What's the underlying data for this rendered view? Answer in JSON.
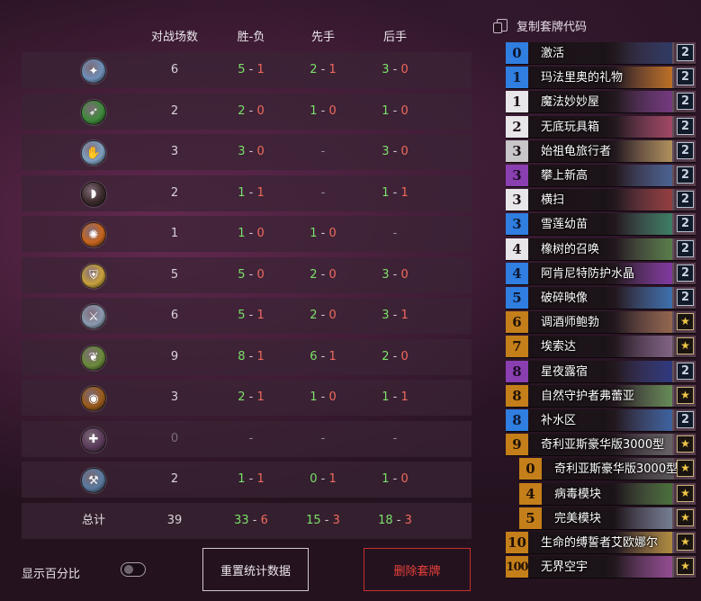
{
  "headers": {
    "games": "对战场数",
    "wl": "胜-负",
    "first": "先手",
    "second": "后手"
  },
  "rows": [
    {
      "icon": "mage-class-icon",
      "glyph": "✦",
      "color": "#6f8fb8",
      "games": "6",
      "wl": [
        "5",
        "1"
      ],
      "first": [
        "2",
        "1"
      ],
      "second": [
        "3",
        "0"
      ]
    },
    {
      "icon": "hunter-class-icon",
      "glyph": "➶",
      "color": "#3d8a3a",
      "games": "2",
      "wl": [
        "2",
        "0"
      ],
      "first": [
        "1",
        "0"
      ],
      "second": [
        "1",
        "0"
      ]
    },
    {
      "icon": "shaman-class-icon",
      "glyph": "✋",
      "color": "#7ea0c0",
      "games": "3",
      "wl": [
        "3",
        "0"
      ],
      "first": "-",
      "second": [
        "3",
        "0"
      ]
    },
    {
      "icon": "rogue-class-icon",
      "glyph": "◗",
      "color": "#3a2a2a",
      "games": "2",
      "wl": [
        "1",
        "1"
      ],
      "first": "-",
      "second": [
        "1",
        "1"
      ]
    },
    {
      "icon": "warlock-class-icon",
      "glyph": "✺",
      "color": "#c8641c",
      "games": "1",
      "wl": [
        "1",
        "0"
      ],
      "first": [
        "1",
        "0"
      ],
      "second": "-"
    },
    {
      "icon": "paladin-class-icon",
      "glyph": "⛨",
      "color": "#c9a13a",
      "games": "5",
      "wl": [
        "5",
        "0"
      ],
      "first": [
        "2",
        "0"
      ],
      "second": [
        "3",
        "0"
      ]
    },
    {
      "icon": "warrior-class-icon",
      "glyph": "⚔",
      "color": "#8a9ab0",
      "games": "6",
      "wl": [
        "5",
        "1"
      ],
      "first": [
        "2",
        "0"
      ],
      "second": [
        "3",
        "1"
      ]
    },
    {
      "icon": "druid-class-icon",
      "glyph": "❦",
      "color": "#6a8a3a",
      "games": "9",
      "wl": [
        "8",
        "1"
      ],
      "first": [
        "6",
        "1"
      ],
      "second": [
        "2",
        "0"
      ]
    },
    {
      "icon": "demonhunter-class-icon",
      "glyph": "◉",
      "color": "#9a5a1a",
      "games": "3",
      "wl": [
        "2",
        "1"
      ],
      "first": [
        "1",
        "0"
      ],
      "second": [
        "1",
        "1"
      ]
    },
    {
      "icon": "priest-class-icon",
      "glyph": "✚",
      "color": "#5a3a5a",
      "games": "0",
      "wl": "-",
      "first": "-",
      "second": "-"
    },
    {
      "icon": "deathknight-class-icon",
      "glyph": "⚒",
      "color": "#5a7aa0",
      "games": "2",
      "wl": [
        "1",
        "1"
      ],
      "first": [
        "0",
        "1"
      ],
      "second": [
        "1",
        "0"
      ]
    }
  ],
  "total": {
    "label": "总计",
    "games": "39",
    "wl": [
      "33",
      "6"
    ],
    "first": [
      "15",
      "3"
    ],
    "second": [
      "18",
      "3"
    ]
  },
  "controls": {
    "show_percent": "显示百分比",
    "reset": "重置统计数据",
    "delete": "删除套牌"
  },
  "deck": {
    "copy_label": "复制套牌代码",
    "cards": [
      {
        "cost": "0",
        "rarity": "rare",
        "name": "激活",
        "qty": "2",
        "art": "#2a3a6a"
      },
      {
        "cost": "1",
        "rarity": "rare",
        "name": "玛法里奥的礼物",
        "qty": "2",
        "art": "#d07a20"
      },
      {
        "cost": "1",
        "rarity": "common",
        "name": "魔法妙妙屋",
        "qty": "2",
        "art": "#7a3a8a"
      },
      {
        "cost": "2",
        "rarity": "common",
        "name": "无底玩具箱",
        "qty": "2",
        "art": "#b04a6a"
      },
      {
        "cost": "3",
        "rarity": "gray",
        "name": "始祖龟旅行者",
        "qty": "2",
        "art": "#c0a060"
      },
      {
        "cost": "3",
        "rarity": "epic",
        "name": "攀上新高",
        "qty": "2",
        "art": "#4a6aa0"
      },
      {
        "cost": "3",
        "rarity": "common",
        "name": "横扫",
        "qty": "2",
        "art": "#a04040"
      },
      {
        "cost": "3",
        "rarity": "rare",
        "name": "雪莲幼苗",
        "qty": "2",
        "art": "#3a8a6a"
      },
      {
        "cost": "4",
        "rarity": "common",
        "name": "橡树的召唤",
        "qty": "2",
        "art": "#5a8a4a"
      },
      {
        "cost": "4",
        "rarity": "rare",
        "name": "阿肯尼特防护水晶",
        "qty": "2",
        "art": "#8a3ab0"
      },
      {
        "cost": "5",
        "rarity": "rare",
        "name": "破碎映像",
        "qty": "2",
        "art": "#3a7ac0"
      },
      {
        "cost": "6",
        "rarity": "leg",
        "name": "调酒师鲍勃",
        "qty": "★",
        "art": "#a07050"
      },
      {
        "cost": "7",
        "rarity": "leg",
        "name": "埃索达",
        "qty": "★",
        "art": "#8a6a90"
      },
      {
        "cost": "8",
        "rarity": "epic",
        "name": "星夜露宿",
        "qty": "2",
        "art": "#2a3a8a"
      },
      {
        "cost": "8",
        "rarity": "leg",
        "name": "自然守护者弗蕾亚",
        "qty": "★",
        "art": "#6a9a5a"
      },
      {
        "cost": "8",
        "rarity": "rare",
        "name": "补水区",
        "qty": "2",
        "art": "#3a6ab0"
      },
      {
        "cost": "9",
        "rarity": "leg",
        "name": "奇利亚斯豪华版3000型",
        "qty": "★",
        "art": "#6a6a6a"
      },
      {
        "cost": "0",
        "rarity": "leg",
        "name": "奇利亚斯豪华版3000型",
        "qty": "★",
        "art": "#5a5a5a",
        "sub": true
      },
      {
        "cost": "4",
        "rarity": "leg",
        "name": "病毒模块",
        "qty": "★",
        "art": "#4a7a3a",
        "sub": true
      },
      {
        "cost": "5",
        "rarity": "leg",
        "name": "完美模块",
        "qty": "★",
        "art": "#7a8aa0",
        "sub": true
      },
      {
        "cost": "10",
        "rarity": "leg",
        "name": "生命的缚誓者艾欧娜尔",
        "qty": "★",
        "art": "#c09a40"
      },
      {
        "cost": "100",
        "rarity": "leg",
        "name": "无界空宇",
        "qty": "★",
        "art": "#a050a0"
      }
    ]
  }
}
